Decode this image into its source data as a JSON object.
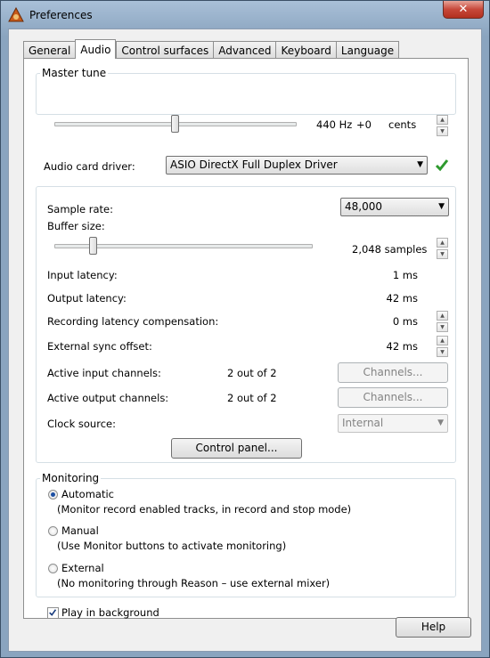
{
  "window": {
    "title": "Preferences",
    "close_glyph": "✕"
  },
  "tabs": [
    "General",
    "Audio",
    "Control surfaces",
    "Advanced",
    "Keyboard",
    "Language"
  ],
  "active_tab": "Audio",
  "master_tune": {
    "label": "Master tune",
    "frequency": "440 Hz",
    "offset": "+0",
    "unit": "cents",
    "slider_level": 0.5
  },
  "audio_driver": {
    "label": "Audio card driver:",
    "value": "ASIO DirectX Full Duplex Driver",
    "status_icon": "green-check-icon"
  },
  "settings": {
    "sample_rate_label": "Sample rate:",
    "sample_rate_value": "48,000",
    "buffer_size_label": "Buffer size:",
    "buffer_size_value": "2,048 samples",
    "buffer_slider_level": 0.14,
    "input_latency_label": "Input latency:",
    "input_latency_value": "1 ms",
    "output_latency_label": "Output latency:",
    "output_latency_value": "42 ms",
    "rec_comp_label": "Recording latency compensation:",
    "rec_comp_value": "0 ms",
    "ext_sync_label": "External sync offset:",
    "ext_sync_value": "42 ms",
    "active_in_label": "Active input channels:",
    "active_in_value": "2 out of 2",
    "active_out_label": "Active output channels:",
    "active_out_value": "2 out of 2",
    "channels_button": "Channels...",
    "clock_label": "Clock source:",
    "clock_value": "Internal",
    "control_panel_button": "Control panel..."
  },
  "monitoring": {
    "title": "Monitoring",
    "options": [
      {
        "label": "Automatic",
        "desc": "(Monitor record enabled tracks, in record and stop mode)",
        "selected": true
      },
      {
        "label": "Manual",
        "desc": "(Use Monitor buttons to activate monitoring)",
        "selected": false
      },
      {
        "label": "External",
        "desc": "(No monitoring through Reason – use external mixer)",
        "selected": false
      }
    ]
  },
  "play_in_background": {
    "label": "Play in background",
    "checked": true
  },
  "help_button": "Help",
  "colors": {
    "accent_check": "#2e9a2e",
    "title_bar": "#8aa4bf",
    "close_button": "#c7483a"
  }
}
